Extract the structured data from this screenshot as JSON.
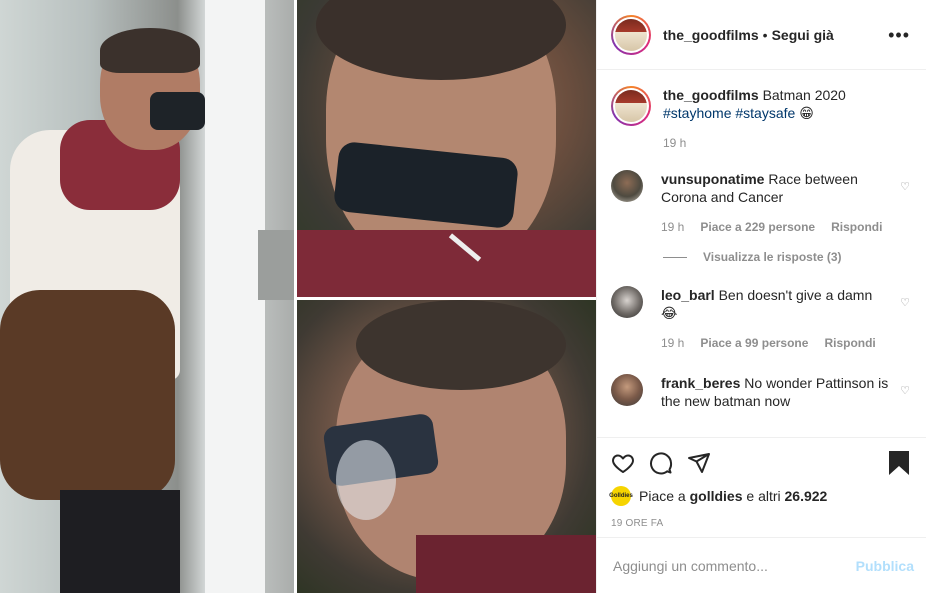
{
  "post": {
    "account": "the_goodfilms",
    "follow_label": "Segui già",
    "more_label": "•••"
  },
  "caption": {
    "username": "the_goodfilms",
    "text": "Batman 2020",
    "hashtag1": "#stayhome",
    "hashtag2": "#staysafe",
    "emoji": "😁",
    "time": "19 h"
  },
  "comments": [
    {
      "username": "vunsuponatime",
      "text": "Race between Corona and Cancer",
      "time": "19 h",
      "likes": "Piace a 229 persone",
      "reply": "Rispondi",
      "view_replies": "Visualizza le risposte (3)"
    },
    {
      "username": "leo_barl",
      "text": "Ben doesn't give a damn 😂",
      "time": "19 h",
      "likes": "Piace a 99 persone",
      "reply": "Rispondi"
    },
    {
      "username": "frank_beres",
      "text": "No wonder Pattinson is the new batman now"
    }
  ],
  "likes": {
    "mini_avatar_text": "Golldies",
    "prefix": "Piace a ",
    "user": "golldies",
    "middle": " e altri ",
    "count": "26.922"
  },
  "time_ago": "19 ORE FA",
  "add_comment": {
    "placeholder": "Aggiungi un commento...",
    "publish": "Pubblica"
  },
  "icons": {
    "like": "heart-icon",
    "comment": "comment-icon",
    "share": "share-icon",
    "save": "bookmark-icon",
    "more": "more-icon"
  }
}
